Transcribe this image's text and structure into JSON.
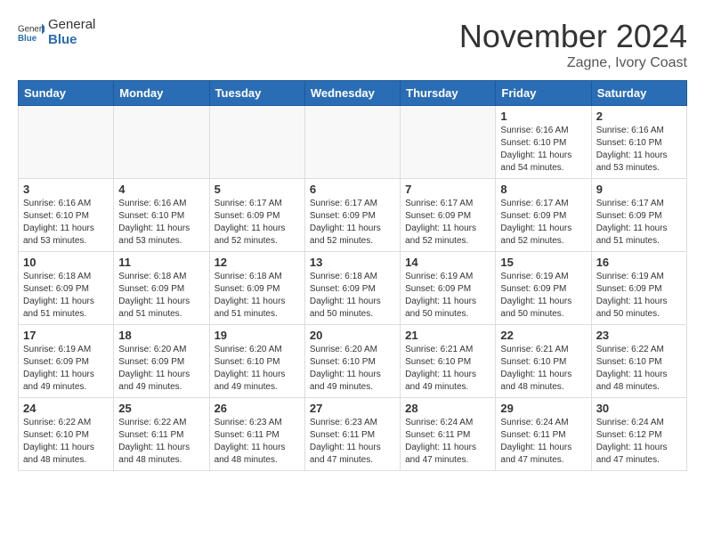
{
  "header": {
    "logo_general": "General",
    "logo_blue": "Blue",
    "month_year": "November 2024",
    "location": "Zagne, Ivory Coast"
  },
  "days_of_week": [
    "Sunday",
    "Monday",
    "Tuesday",
    "Wednesday",
    "Thursday",
    "Friday",
    "Saturday"
  ],
  "weeks": [
    [
      {
        "day": "",
        "info": ""
      },
      {
        "day": "",
        "info": ""
      },
      {
        "day": "",
        "info": ""
      },
      {
        "day": "",
        "info": ""
      },
      {
        "day": "",
        "info": ""
      },
      {
        "day": "1",
        "info": "Sunrise: 6:16 AM\nSunset: 6:10 PM\nDaylight: 11 hours\nand 54 minutes."
      },
      {
        "day": "2",
        "info": "Sunrise: 6:16 AM\nSunset: 6:10 PM\nDaylight: 11 hours\nand 53 minutes."
      }
    ],
    [
      {
        "day": "3",
        "info": "Sunrise: 6:16 AM\nSunset: 6:10 PM\nDaylight: 11 hours\nand 53 minutes."
      },
      {
        "day": "4",
        "info": "Sunrise: 6:16 AM\nSunset: 6:10 PM\nDaylight: 11 hours\nand 53 minutes."
      },
      {
        "day": "5",
        "info": "Sunrise: 6:17 AM\nSunset: 6:09 PM\nDaylight: 11 hours\nand 52 minutes."
      },
      {
        "day": "6",
        "info": "Sunrise: 6:17 AM\nSunset: 6:09 PM\nDaylight: 11 hours\nand 52 minutes."
      },
      {
        "day": "7",
        "info": "Sunrise: 6:17 AM\nSunset: 6:09 PM\nDaylight: 11 hours\nand 52 minutes."
      },
      {
        "day": "8",
        "info": "Sunrise: 6:17 AM\nSunset: 6:09 PM\nDaylight: 11 hours\nand 52 minutes."
      },
      {
        "day": "9",
        "info": "Sunrise: 6:17 AM\nSunset: 6:09 PM\nDaylight: 11 hours\nand 51 minutes."
      }
    ],
    [
      {
        "day": "10",
        "info": "Sunrise: 6:18 AM\nSunset: 6:09 PM\nDaylight: 11 hours\nand 51 minutes."
      },
      {
        "day": "11",
        "info": "Sunrise: 6:18 AM\nSunset: 6:09 PM\nDaylight: 11 hours\nand 51 minutes."
      },
      {
        "day": "12",
        "info": "Sunrise: 6:18 AM\nSunset: 6:09 PM\nDaylight: 11 hours\nand 51 minutes."
      },
      {
        "day": "13",
        "info": "Sunrise: 6:18 AM\nSunset: 6:09 PM\nDaylight: 11 hours\nand 50 minutes."
      },
      {
        "day": "14",
        "info": "Sunrise: 6:19 AM\nSunset: 6:09 PM\nDaylight: 11 hours\nand 50 minutes."
      },
      {
        "day": "15",
        "info": "Sunrise: 6:19 AM\nSunset: 6:09 PM\nDaylight: 11 hours\nand 50 minutes."
      },
      {
        "day": "16",
        "info": "Sunrise: 6:19 AM\nSunset: 6:09 PM\nDaylight: 11 hours\nand 50 minutes."
      }
    ],
    [
      {
        "day": "17",
        "info": "Sunrise: 6:19 AM\nSunset: 6:09 PM\nDaylight: 11 hours\nand 49 minutes."
      },
      {
        "day": "18",
        "info": "Sunrise: 6:20 AM\nSunset: 6:09 PM\nDaylight: 11 hours\nand 49 minutes."
      },
      {
        "day": "19",
        "info": "Sunrise: 6:20 AM\nSunset: 6:10 PM\nDaylight: 11 hours\nand 49 minutes."
      },
      {
        "day": "20",
        "info": "Sunrise: 6:20 AM\nSunset: 6:10 PM\nDaylight: 11 hours\nand 49 minutes."
      },
      {
        "day": "21",
        "info": "Sunrise: 6:21 AM\nSunset: 6:10 PM\nDaylight: 11 hours\nand 49 minutes."
      },
      {
        "day": "22",
        "info": "Sunrise: 6:21 AM\nSunset: 6:10 PM\nDaylight: 11 hours\nand 48 minutes."
      },
      {
        "day": "23",
        "info": "Sunrise: 6:22 AM\nSunset: 6:10 PM\nDaylight: 11 hours\nand 48 minutes."
      }
    ],
    [
      {
        "day": "24",
        "info": "Sunrise: 6:22 AM\nSunset: 6:10 PM\nDaylight: 11 hours\nand 48 minutes."
      },
      {
        "day": "25",
        "info": "Sunrise: 6:22 AM\nSunset: 6:11 PM\nDaylight: 11 hours\nand 48 minutes."
      },
      {
        "day": "26",
        "info": "Sunrise: 6:23 AM\nSunset: 6:11 PM\nDaylight: 11 hours\nand 48 minutes."
      },
      {
        "day": "27",
        "info": "Sunrise: 6:23 AM\nSunset: 6:11 PM\nDaylight: 11 hours\nand 47 minutes."
      },
      {
        "day": "28",
        "info": "Sunrise: 6:24 AM\nSunset: 6:11 PM\nDaylight: 11 hours\nand 47 minutes."
      },
      {
        "day": "29",
        "info": "Sunrise: 6:24 AM\nSunset: 6:11 PM\nDaylight: 11 hours\nand 47 minutes."
      },
      {
        "day": "30",
        "info": "Sunrise: 6:24 AM\nSunset: 6:12 PM\nDaylight: 11 hours\nand 47 minutes."
      }
    ]
  ]
}
